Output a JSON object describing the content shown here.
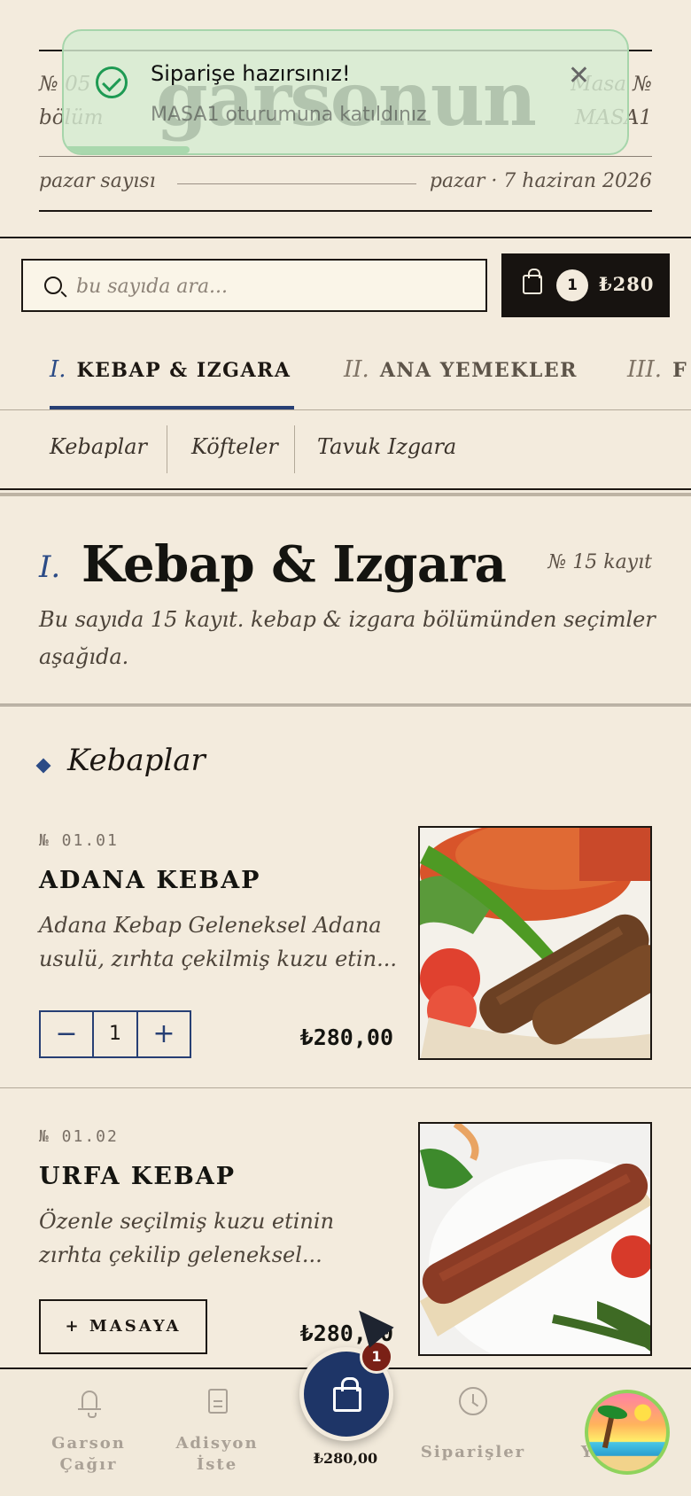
{
  "masthead": {
    "issue_no": "№ 05",
    "section_word": "bölüm",
    "logo": "garsonun",
    "table_label": "Masa №",
    "table_value": "MASA1",
    "issue_label": "pazar sayısı",
    "date": "pazar · 7 haziran 2026"
  },
  "toast": {
    "title": "Siparişe hazırsınız!",
    "subtitle": "MASA1 oturumuna katıldınız",
    "close_icon": "close-icon",
    "check_icon": "check-circle-icon",
    "accent": "#1e9a53"
  },
  "search": {
    "placeholder": "bu sayıda ara..."
  },
  "cart": {
    "count": "1",
    "total": "₺280"
  },
  "tabs": [
    {
      "num": "I.",
      "label": "KEBAP & IZGARA",
      "active": true
    },
    {
      "num": "II.",
      "label": "ANA YEMEKLER",
      "active": false
    },
    {
      "num": "III.",
      "label": "F",
      "active": false
    }
  ],
  "subcategories": [
    "Kebaplar",
    "Köfteler",
    "Tavuk Izgara"
  ],
  "section": {
    "numeral": "I.",
    "title": "Kebap & Izgara",
    "count": "№ 15 kayıt",
    "description": "Bu sayıda 15 kayıt. kebap & izgara bölümünden seçimler aşağıda."
  },
  "group": {
    "title": "Kebaplar"
  },
  "items": [
    {
      "no": "№ 01.01",
      "name": "ADANA KEBAP",
      "description": "Adana Kebap Geleneksel Adana usulü, zırhta çekilmiş kuzu etin...",
      "quantity": "1",
      "price": "₺280,00"
    },
    {
      "no": "№ 01.02",
      "name": "URFA KEBAP",
      "description": "Özenle seçilmiş kuzu etinin zırhta çekilip geleneksel...",
      "add_label": "+ MASAYA",
      "price": "₺280,00"
    }
  ],
  "bottom_nav": {
    "items": [
      {
        "label_1": "Garson",
        "label_2": "Çağır",
        "icon": "bell-icon"
      },
      {
        "label_1": "Adisyon",
        "label_2": "İste",
        "icon": "receipt-icon"
      },
      {
        "label_1": "Siparişler",
        "label_2": "",
        "icon": "clock-icon"
      },
      {
        "label_1": "Yu",
        "label_2": "",
        "icon": ""
      }
    ],
    "cart_badge": "1",
    "cart_total": "₺280,00"
  },
  "colors": {
    "background": "#f3ebdd",
    "ink": "#1c1712",
    "accent_blue": "#2b4b86",
    "badge_red": "#7a2016"
  }
}
